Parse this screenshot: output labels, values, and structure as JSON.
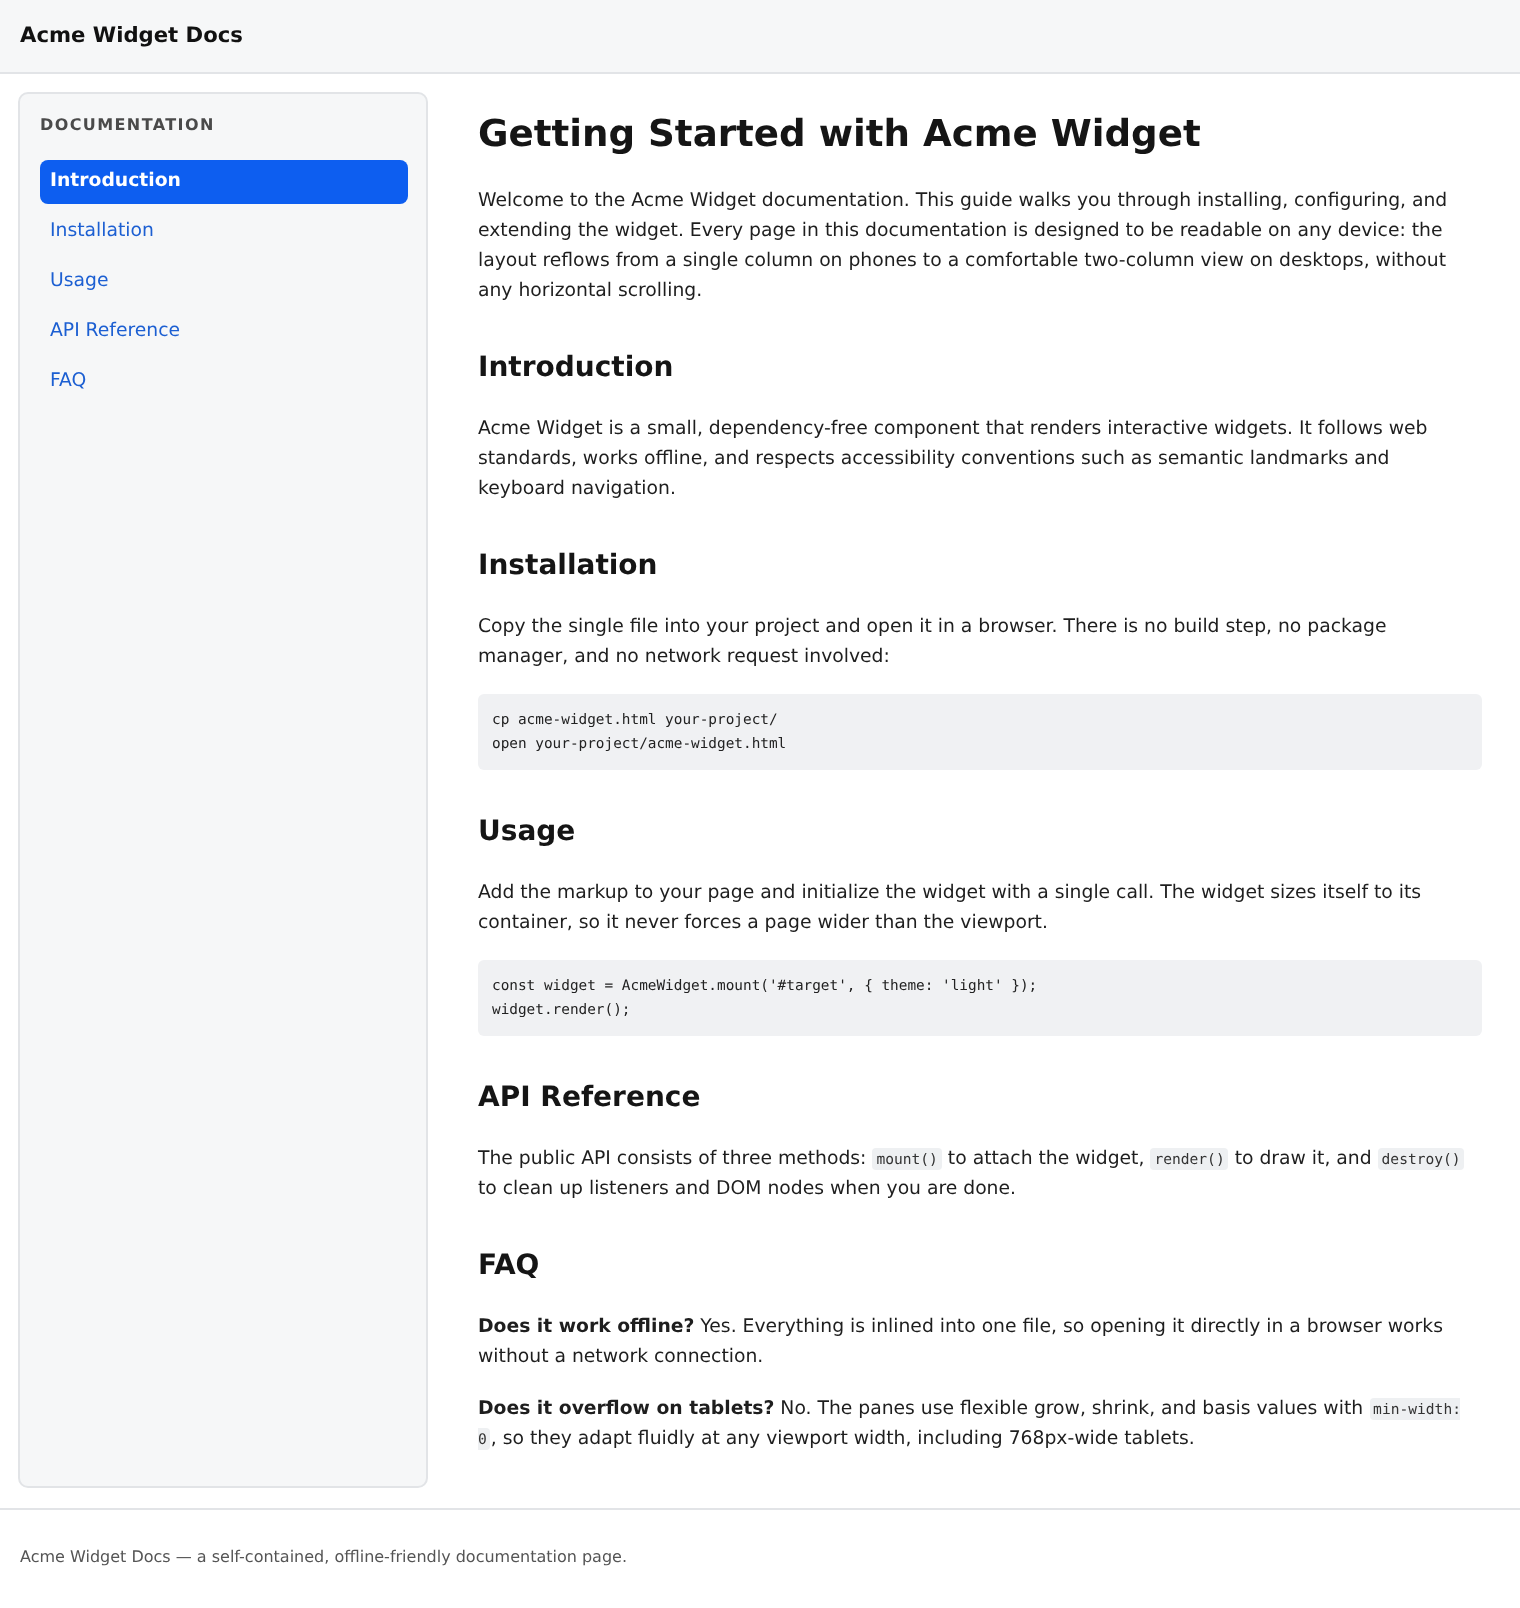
{
  "header": {
    "title": "Acme Widget Docs"
  },
  "sidebar": {
    "heading": "DOCUMENTATION",
    "items": [
      {
        "label": "Introduction",
        "selected": true
      },
      {
        "label": "Installation",
        "selected": false
      },
      {
        "label": "Usage",
        "selected": false
      },
      {
        "label": "API Reference",
        "selected": false
      },
      {
        "label": "FAQ",
        "selected": false
      }
    ]
  },
  "content": {
    "title": "Getting Started with Acme Widget",
    "intro": {
      "parts": [
        {
          "kind": "text",
          "text": "Welcome to the Acme Widget documentation. This guide walks you through installing, configuring, and extending the widget. Every page in this documentation is designed to be readable on any device: the layout reflows from a single column on phones to a comfortable two-column view on desktops, without any horizontal scrolling."
        }
      ]
    },
    "sections": [
      {
        "heading": "Introduction",
        "blocks": [
          {
            "kind": "paragraph",
            "parts": [
              {
                "kind": "text",
                "text": "Acme Widget is a small, dependency-free component that renders interactive widgets. It follows web standards, works offline, and respects accessibility conventions such as semantic landmarks and keyboard navigation."
              }
            ]
          }
        ]
      },
      {
        "heading": "Installation",
        "blocks": [
          {
            "kind": "paragraph",
            "parts": [
              {
                "kind": "text",
                "text": "Copy the single file into your project and open it in a browser. There is no build step, no package manager, and no network request involved:"
              }
            ]
          },
          {
            "kind": "code",
            "lines": [
              "cp acme-widget.html your-project/",
              "open your-project/acme-widget.html"
            ]
          }
        ]
      },
      {
        "heading": "Usage",
        "blocks": [
          {
            "kind": "paragraph",
            "parts": [
              {
                "kind": "text",
                "text": "Add the markup to your page and initialize the widget with a single call. The widget sizes itself to its container, so it never forces a page wider than the viewport."
              }
            ]
          },
          {
            "kind": "code",
            "lines": [
              "const widget = AcmeWidget.mount('#target', { theme: 'light' });",
              "widget.render();"
            ]
          }
        ]
      },
      {
        "heading": "API Reference",
        "blocks": [
          {
            "kind": "paragraph",
            "parts": [
              {
                "kind": "text",
                "text": "The public API consists of three methods: "
              },
              {
                "kind": "code",
                "text": "mount()"
              },
              {
                "kind": "text",
                "text": " to attach the widget, "
              },
              {
                "kind": "code",
                "text": "render()"
              },
              {
                "kind": "text",
                "text": " to draw it, and "
              },
              {
                "kind": "code",
                "text": "destroy()"
              },
              {
                "kind": "text",
                "text": " to clean up listeners and DOM nodes when you are done."
              }
            ]
          }
        ]
      },
      {
        "heading": "FAQ",
        "blocks": [
          {
            "kind": "paragraph",
            "parts": [
              {
                "kind": "text",
                "text": "**Does it work offline?** Yes. Everything is inlined into one file, so opening it directly in a browser works without a network connection."
              }
            ]
          },
          {
            "kind": "paragraph",
            "parts": [
              {
                "kind": "text",
                "text": "**Does it overflow on tablets?** No. The panes use flexible grow, shrink, and basis values with "
              },
              {
                "kind": "code",
                "text": "min-width: 0"
              },
              {
                "kind": "text",
                "text": ", so they adapt fluidly at any viewport width, including 768px-wide tablets."
              }
            ]
          }
        ]
      }
    ]
  },
  "footer": {
    "text": "Acme Widget Docs — a self-contained, offline-friendly documentation page."
  }
}
